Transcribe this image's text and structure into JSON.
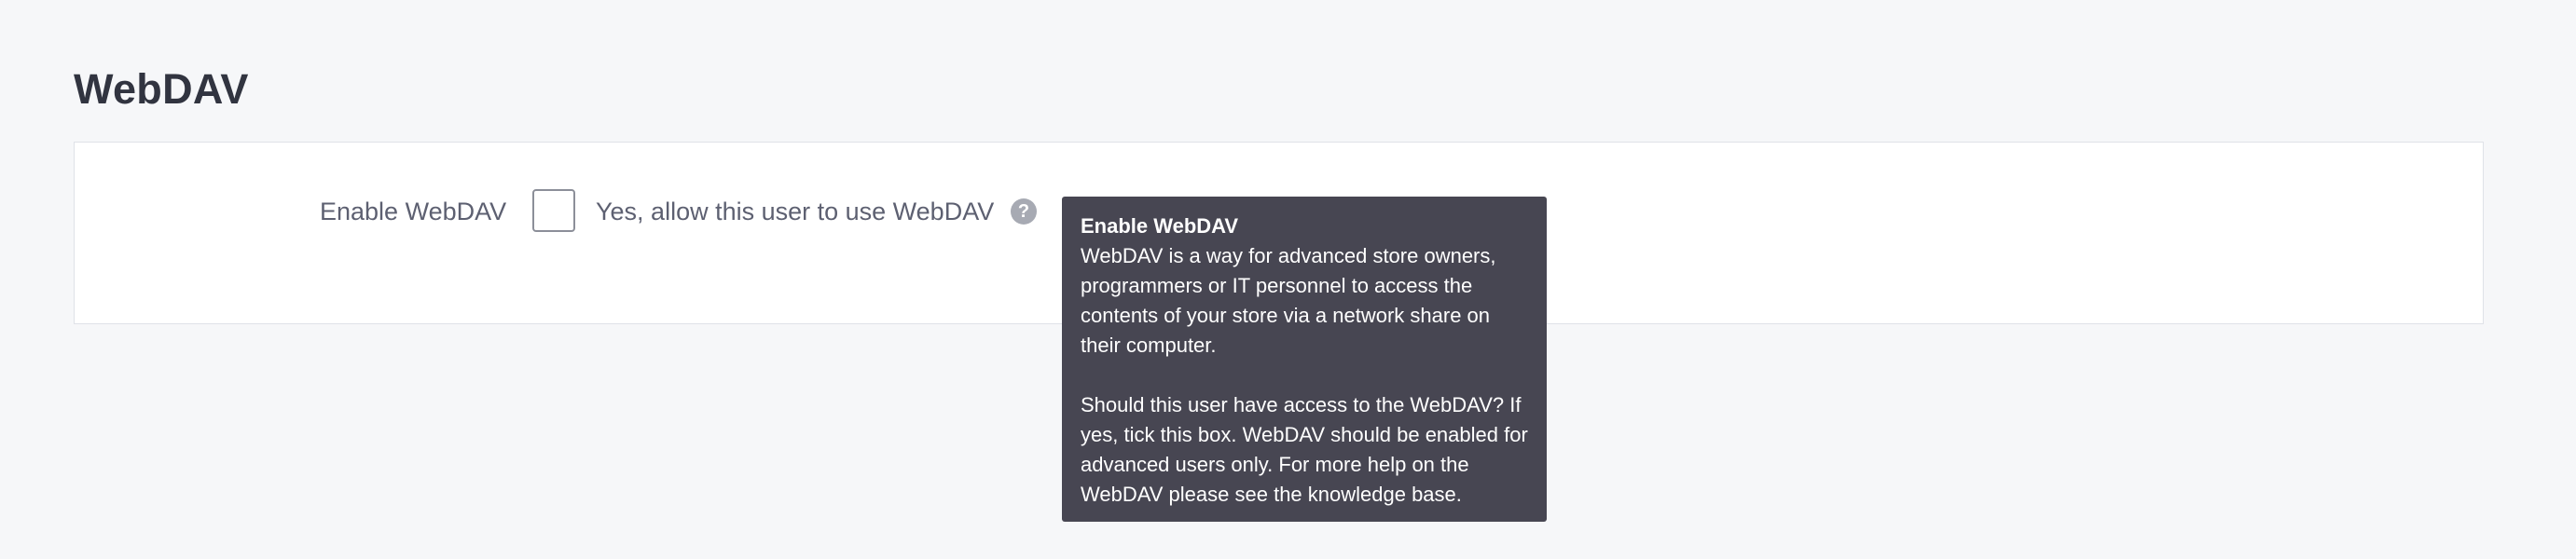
{
  "section": {
    "title": "WebDAV"
  },
  "field": {
    "label": "Enable WebDAV",
    "checkbox_label": "Yes, allow this user to use WebDAV",
    "checked": false,
    "help_icon": "question-circle-icon"
  },
  "tooltip": {
    "title": "Enable WebDAV",
    "paragraph1": "WebDAV is a way for advanced store owners, programmers or IT personnel to access the contents of your store via a network share on their computer.",
    "paragraph2": "Should this user have access to the WebDAV? If yes, tick this box. WebDAV should be enabled for advanced users only. For more help on the WebDAV please see the knowledge base."
  },
  "colors": {
    "background": "#f6f7f9",
    "panel": "#ffffff",
    "tooltip_bg": "#474652",
    "text": "#313440",
    "muted_text": "#5d6071",
    "help_icon": "#a7aab3"
  }
}
